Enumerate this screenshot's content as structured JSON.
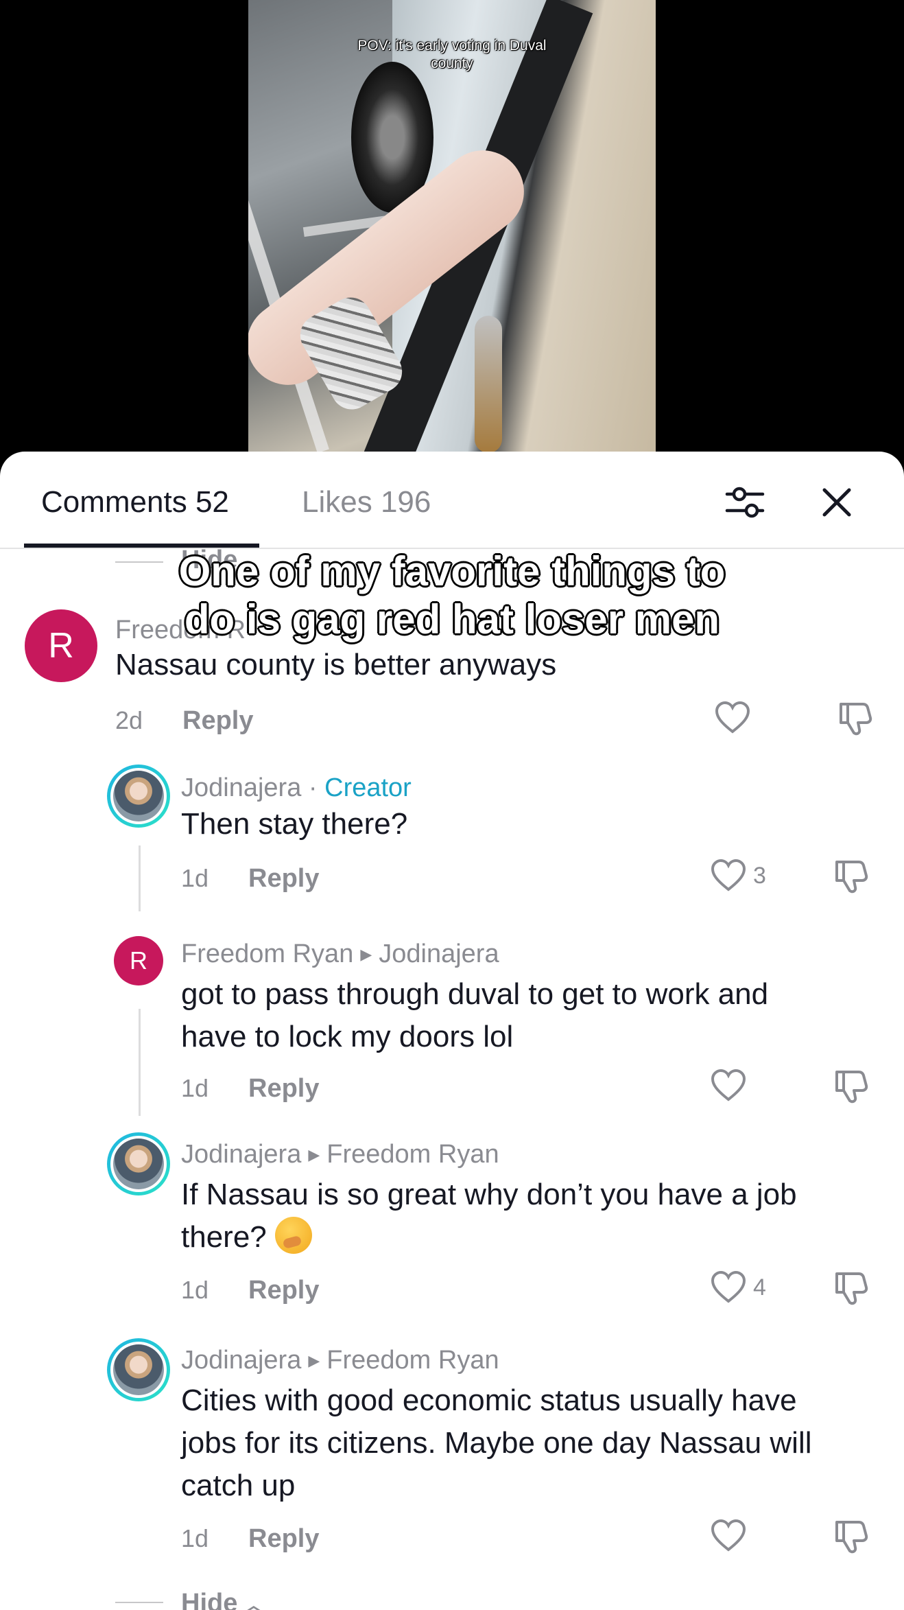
{
  "video": {
    "caption_line1": "POV: it's early voting in Duval",
    "caption_line2": "county",
    "overlay_line1": "One of my favorite things to",
    "overlay_line2": "do is gag red hat loser men"
  },
  "tabs": {
    "comments_label": "Comments 52",
    "likes_label": "Likes 196"
  },
  "icons": {
    "filter": "sliders-icon",
    "close": "close-icon",
    "like": "heart-icon",
    "dislike": "thumbs-down-icon"
  },
  "hide_top": "Hide",
  "hide_bottom": "Hide",
  "comments": [
    {
      "avatar_letter": "R",
      "author": "Freedom R",
      "text": "Nassau county is better anyways",
      "time": "2d",
      "reply_label": "Reply",
      "likes": ""
    },
    {
      "author": "Jodinajera",
      "badge": "Creator",
      "text": "Then stay there?",
      "time": "1d",
      "reply_label": "Reply",
      "likes": "3"
    },
    {
      "avatar_letter": "R",
      "author": "Freedom Ryan",
      "reply_to": "Jodinajera",
      "text_line1": "got to pass through duval to get to work and",
      "text_line2": "have to lock my doors lol",
      "time": "1d",
      "reply_label": "Reply",
      "likes": ""
    },
    {
      "author": "Jodinajera",
      "reply_to": "Freedom Ryan",
      "text_line1": "If Nassau is so great why don’t you have a job",
      "text_line2": "there?",
      "time": "1d",
      "reply_label": "Reply",
      "likes": "4"
    },
    {
      "author": "Jodinajera",
      "reply_to": "Freedom Ryan",
      "text_line1": "Cities with good economic status usually have",
      "text_line2": "jobs for its citizens. Maybe one day Nassau will",
      "text_line3": "catch up",
      "time": "1d",
      "reply_label": "Reply",
      "likes": ""
    }
  ]
}
